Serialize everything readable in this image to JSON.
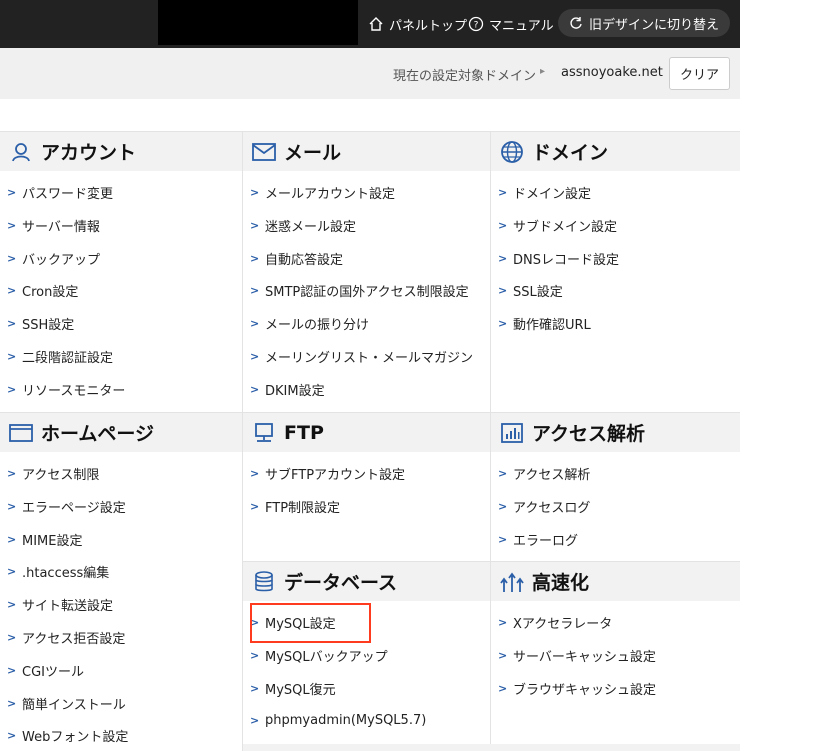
{
  "header": {
    "nav_top": "パネルトップ",
    "nav_manual": "マニュアル",
    "old_design": "旧デザインに切り替え"
  },
  "subbar": {
    "label": "現在の設定対象ドメイン",
    "arrow": "▸",
    "domain": "assnoyoake.net",
    "clear": "クリア"
  },
  "sections": {
    "account": {
      "title": "アカウント",
      "items": [
        "パスワード変更",
        "サーバー情報",
        "バックアップ",
        "Cron設定",
        "SSH設定",
        "二段階認証設定",
        "リソースモニター"
      ]
    },
    "mail": {
      "title": "メール",
      "items": [
        "メールアカウント設定",
        "迷惑メール設定",
        "自動応答設定",
        "SMTP認証の国外アクセス制限設定",
        "メールの振り分け",
        "メーリングリスト・メールマガジン",
        "DKIM設定"
      ]
    },
    "domain": {
      "title": "ドメイン",
      "items": [
        "ドメイン設定",
        "サブドメイン設定",
        "DNSレコード設定",
        "SSL設定",
        "動作確認URL"
      ]
    },
    "homepage": {
      "title": "ホームページ",
      "items": [
        "アクセス制限",
        "エラーページ設定",
        "MIME設定",
        ".htaccess編集",
        "サイト転送設定",
        "アクセス拒否設定",
        "CGIツール",
        "簡単インストール",
        "Webフォント設定"
      ]
    },
    "ftp": {
      "title": "FTP",
      "items": [
        "サブFTPアカウント設定",
        "FTP制限設定"
      ]
    },
    "analytics": {
      "title": "アクセス解析",
      "items": [
        "アクセス解析",
        "アクセスログ",
        "エラーログ"
      ]
    },
    "database": {
      "title": "データベース",
      "items": [
        "MySQL設定",
        "MySQLバックアップ",
        "MySQL復元",
        "phpmyadmin(MySQL5.7)"
      ]
    },
    "speed": {
      "title": "高速化",
      "items": [
        "Xアクセラレータ",
        "サーバーキャッシュ設定",
        "ブラウザキャッシュ設定"
      ]
    }
  },
  "colors": {
    "accent": "#2b5fa8",
    "highlight": "#ff3b1f"
  }
}
